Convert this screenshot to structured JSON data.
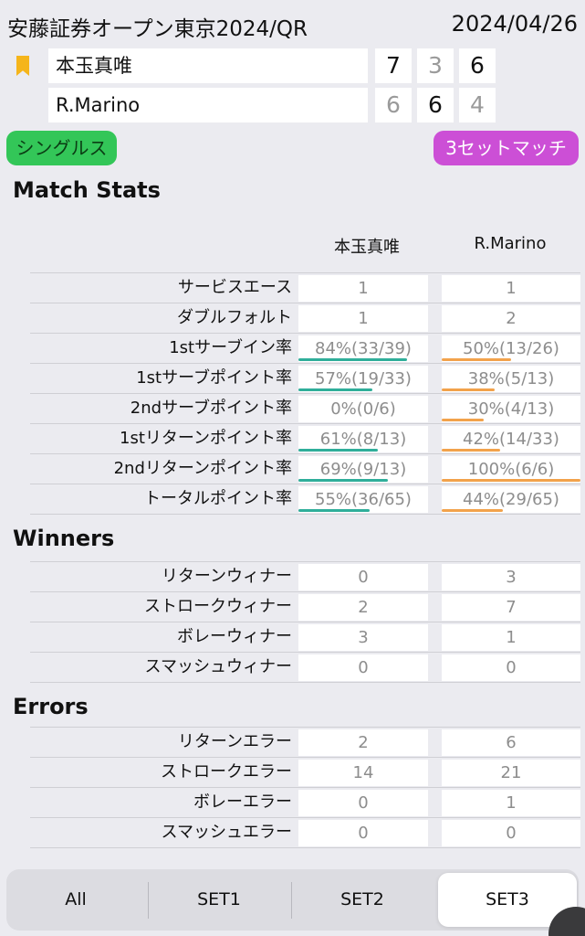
{
  "header": {
    "title": "安藤証券オープン東京2024/QR",
    "date": "2024/04/26"
  },
  "players": [
    {
      "name": "本玉真唯",
      "sets": [
        "7",
        "3",
        "6"
      ],
      "set_wins": [
        true,
        false,
        true
      ],
      "bookmarked": true
    },
    {
      "name": "R.Marino",
      "sets": [
        "6",
        "6",
        "4"
      ],
      "set_wins": [
        false,
        true,
        false
      ],
      "bookmarked": false
    }
  ],
  "badges": {
    "type": "シングルス",
    "format": "3セットマッチ"
  },
  "sections": {
    "match_stats": "Match Stats",
    "winners": "Winners",
    "errors": "Errors"
  },
  "columns": {
    "p1": "本玉真唯",
    "p2": "R.Marino"
  },
  "colors": {
    "p1_bar": "#2fae9a",
    "p2_bar": "#f2a24b",
    "singles": "#33c658",
    "format": "#cc4fd6",
    "bookmark": "#f5b51b"
  },
  "match_stats": [
    {
      "label": "サービスエース",
      "p1": "1",
      "p2": "1"
    },
    {
      "label": "ダブルフォルト",
      "p1": "1",
      "p2": "2"
    },
    {
      "label": "1stサーブイン率",
      "p1": "84%(33/39)",
      "p2": "50%(13/26)",
      "p1_pct": 84,
      "p2_pct": 50
    },
    {
      "label": "1stサーブポイント率",
      "p1": "57%(19/33)",
      "p2": "38%(5/13)",
      "p1_pct": 57,
      "p2_pct": 38
    },
    {
      "label": "2ndサーブポイント率",
      "p1": "0%(0/6)",
      "p2": "30%(4/13)",
      "p1_pct": 0,
      "p2_pct": 30
    },
    {
      "label": "1stリターンポイント率",
      "p1": "61%(8/13)",
      "p2": "42%(14/33)",
      "p1_pct": 61,
      "p2_pct": 42
    },
    {
      "label": "2ndリターンポイント率",
      "p1": "69%(9/13)",
      "p2": "100%(6/6)",
      "p1_pct": 69,
      "p2_pct": 100
    },
    {
      "label": "トータルポイント率",
      "p1": "55%(36/65)",
      "p2": "44%(29/65)",
      "p1_pct": 55,
      "p2_pct": 44
    }
  ],
  "winners": [
    {
      "label": "リターンウィナー",
      "p1": "0",
      "p2": "3"
    },
    {
      "label": "ストロークウィナー",
      "p1": "2",
      "p2": "7"
    },
    {
      "label": "ボレーウィナー",
      "p1": "3",
      "p2": "1"
    },
    {
      "label": "スマッシュウィナー",
      "p1": "0",
      "p2": "0"
    }
  ],
  "errors": [
    {
      "label": "リターンエラー",
      "p1": "2",
      "p2": "6"
    },
    {
      "label": "ストロークエラー",
      "p1": "14",
      "p2": "21"
    },
    {
      "label": "ボレーエラー",
      "p1": "0",
      "p2": "1"
    },
    {
      "label": "スマッシュエラー",
      "p1": "0",
      "p2": "0"
    }
  ],
  "tabs": [
    {
      "label": "All",
      "active": false
    },
    {
      "label": "SET1",
      "active": false
    },
    {
      "label": "SET2",
      "active": false
    },
    {
      "label": "SET3",
      "active": true
    }
  ]
}
